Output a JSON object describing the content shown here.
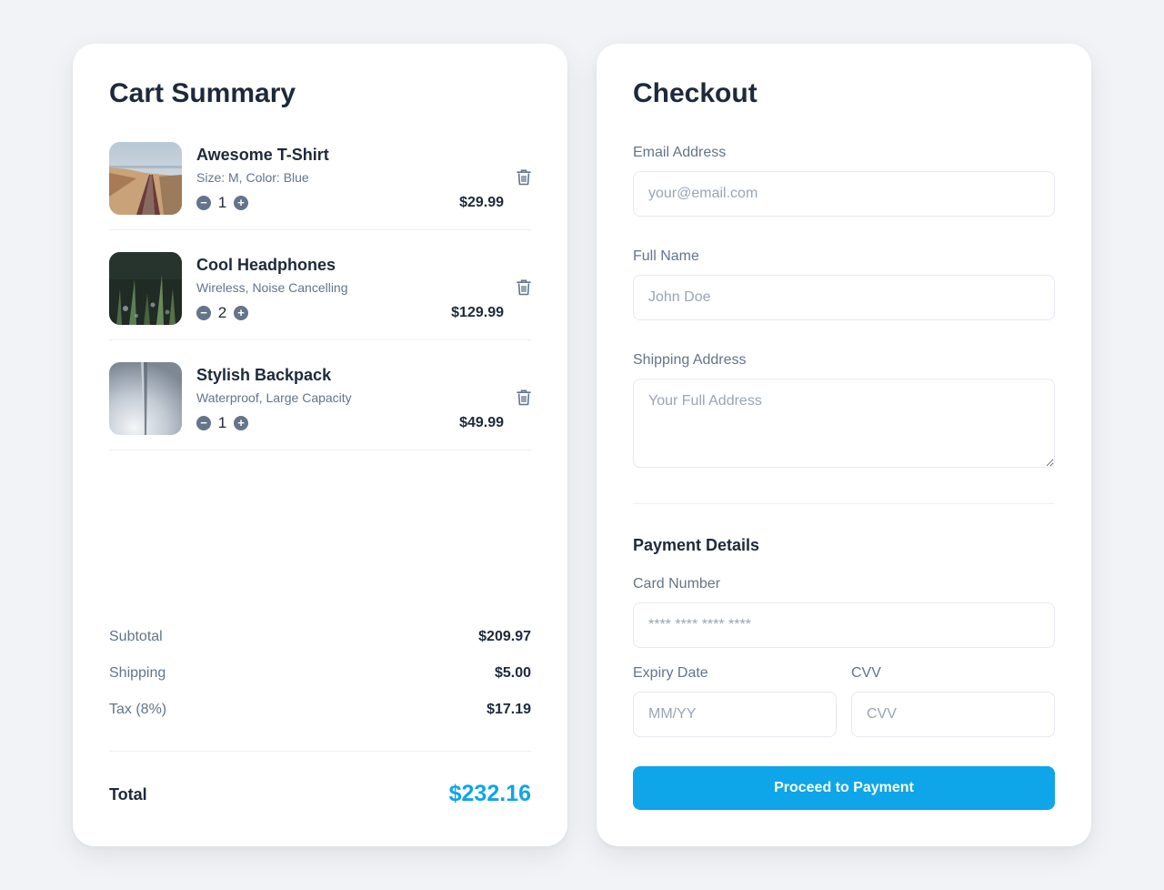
{
  "cart": {
    "title": "Cart Summary",
    "items": [
      {
        "name": "Awesome T-Shirt",
        "desc": "Size: M, Color: Blue",
        "qty": "1",
        "price": "$29.99",
        "image_icon": "railway-photo"
      },
      {
        "name": "Cool Headphones",
        "desc": "Wireless, Noise Cancelling",
        "qty": "2",
        "price": "$129.99",
        "image_icon": "plants-photo"
      },
      {
        "name": "Stylish Backpack",
        "desc": "Waterproof, Large Capacity",
        "qty": "1",
        "price": "$49.99",
        "image_icon": "sky-photo"
      }
    ],
    "decrement_icon": "minus-icon",
    "increment_icon": "plus-icon",
    "remove_icon": "trash-icon",
    "summary": {
      "subtotal_label": "Subtotal",
      "subtotal_value": "$209.97",
      "shipping_label": "Shipping",
      "shipping_value": "$5.00",
      "tax_label": "Tax (8%)",
      "tax_value": "$17.19",
      "total_label": "Total",
      "total_value": "$232.16"
    }
  },
  "checkout": {
    "title": "Checkout",
    "email": {
      "label": "Email Address",
      "placeholder": "your@email.com",
      "value": ""
    },
    "name": {
      "label": "Full Name",
      "placeholder": "John Doe",
      "value": ""
    },
    "address": {
      "label": "Shipping Address",
      "placeholder": "Your Full Address",
      "value": ""
    },
    "payment_title": "Payment Details",
    "card_number": {
      "label": "Card Number",
      "placeholder": "**** **** **** ****",
      "value": ""
    },
    "expiry": {
      "label": "Expiry Date",
      "placeholder": "MM/YY",
      "value": ""
    },
    "cvv": {
      "label": "CVV",
      "placeholder": "CVV",
      "value": ""
    },
    "submit_label": "Proceed to Payment"
  },
  "colors": {
    "accent": "#0ea5e9",
    "text_primary": "#1e293b",
    "text_muted": "#64748b",
    "background": "#f1f3f6"
  }
}
